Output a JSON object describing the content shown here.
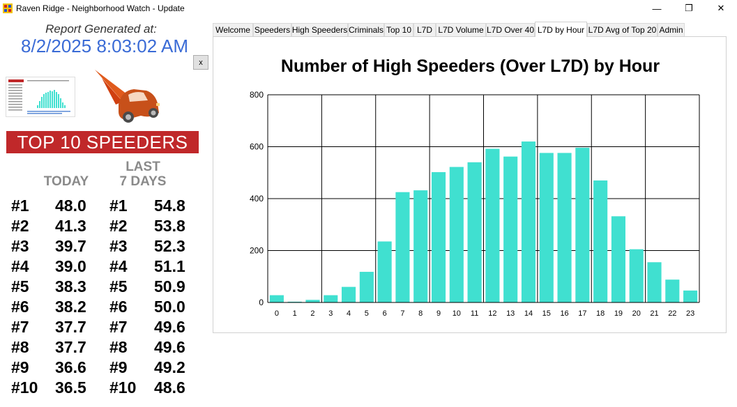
{
  "window": {
    "title": "Raven Ridge - Neighborhood Watch - Update",
    "minimize": "—",
    "restore": "❐",
    "close": "✕"
  },
  "report": {
    "label": "Report Generated at:",
    "timestamp": "8/2/2025 8:03:02 AM",
    "close_button": "x"
  },
  "top10": {
    "title": "TOP 10 SPEEDERS",
    "today_header": "TODAY",
    "last7_header_1": "LAST",
    "last7_header_2": "7 DAYS",
    "rows": [
      {
        "rank": "#1",
        "today": "48.0",
        "rank7": "#1",
        "last7": "54.8"
      },
      {
        "rank": "#2",
        "today": "41.3",
        "rank7": "#2",
        "last7": "53.8"
      },
      {
        "rank": "#3",
        "today": "39.7",
        "rank7": "#3",
        "last7": "52.3"
      },
      {
        "rank": "#4",
        "today": "39.0",
        "rank7": "#4",
        "last7": "51.1"
      },
      {
        "rank": "#5",
        "today": "38.3",
        "rank7": "#5",
        "last7": "50.9"
      },
      {
        "rank": "#6",
        "today": "38.2",
        "rank7": "#6",
        "last7": "50.0"
      },
      {
        "rank": "#7",
        "today": "37.7",
        "rank7": "#7",
        "last7": "49.6"
      },
      {
        "rank": "#8",
        "today": "37.7",
        "rank7": "#8",
        "last7": "49.6"
      },
      {
        "rank": "#9",
        "today": "36.6",
        "rank7": "#9",
        "last7": "49.2"
      },
      {
        "rank": "#10",
        "today": "36.5",
        "rank7": "#10",
        "last7": "48.6"
      }
    ]
  },
  "tabs": [
    {
      "label": "Welcome"
    },
    {
      "label": "Speeders"
    },
    {
      "label": "High Speeders"
    },
    {
      "label": "Criminals"
    },
    {
      "label": "Top 10"
    },
    {
      "label": "L7D"
    },
    {
      "label": "L7D Volume"
    },
    {
      "label": "L7D Over 40"
    },
    {
      "label": "L7D by Hour",
      "active": true
    },
    {
      "label": "L7D Avg of Top 20"
    },
    {
      "label": "Admin"
    }
  ],
  "colors": {
    "bar": "#40e0d0",
    "banner": "#c0282a",
    "timestamp": "#3a6bd6"
  },
  "chart_data": {
    "type": "bar",
    "title": "Number of High Speeders (Over L7D) by Hour",
    "categories": [
      "0",
      "1",
      "2",
      "3",
      "4",
      "5",
      "6",
      "7",
      "8",
      "9",
      "10",
      "11",
      "12",
      "13",
      "14",
      "15",
      "16",
      "17",
      "18",
      "19",
      "20",
      "21",
      "22",
      "23"
    ],
    "values": [
      28,
      3,
      10,
      28,
      60,
      118,
      235,
      425,
      432,
      502,
      522,
      540,
      592,
      562,
      620,
      576,
      576,
      596,
      470,
      332,
      205,
      155,
      88,
      46
    ],
    "yticks": [
      "0",
      "200",
      "400",
      "600",
      "800"
    ],
    "ylim": [
      0,
      800
    ],
    "xlabel": "",
    "ylabel": "",
    "grid": true
  }
}
